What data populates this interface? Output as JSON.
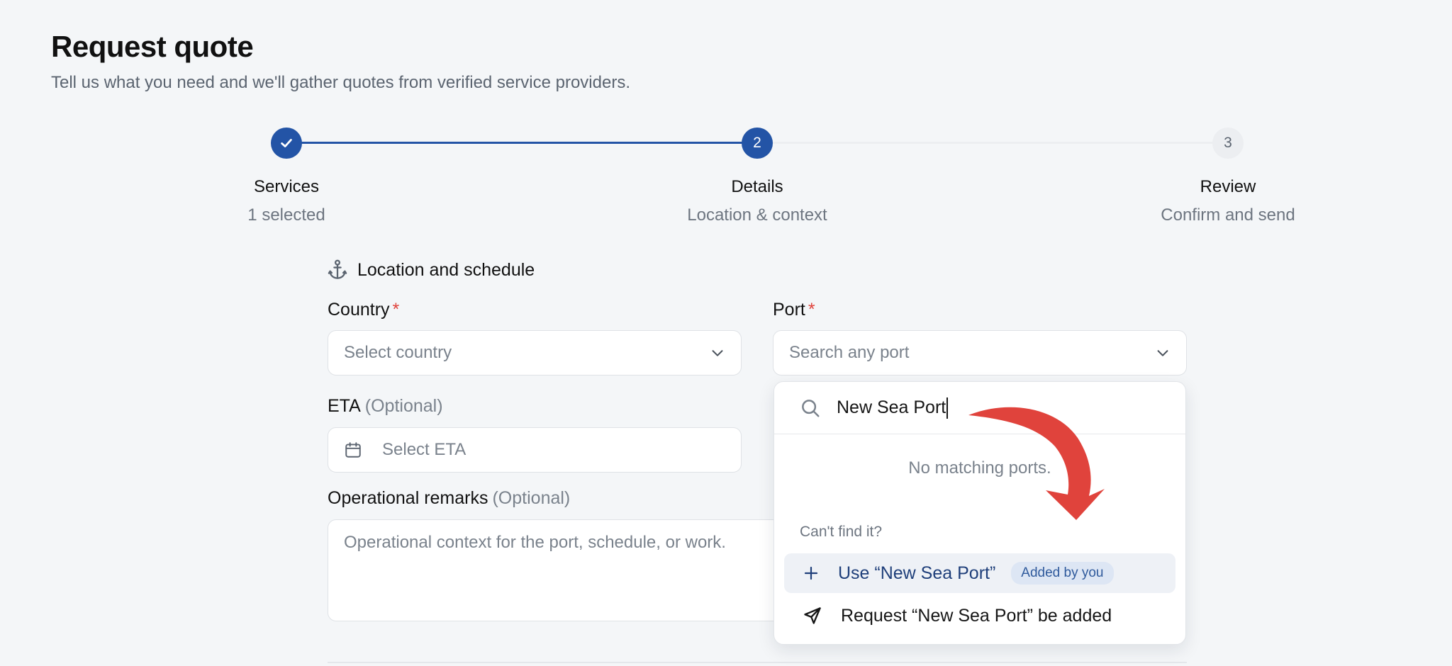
{
  "header": {
    "title": "Request quote",
    "subtitle": "Tell us what you need and we'll gather quotes from verified service providers."
  },
  "stepper": {
    "steps": [
      {
        "number": "",
        "label": "Services",
        "sub": "1 selected",
        "state": "done"
      },
      {
        "number": "2",
        "label": "Details",
        "sub": "Location & context",
        "state": "current"
      },
      {
        "number": "3",
        "label": "Review",
        "sub": "Confirm and send",
        "state": "upcoming"
      }
    ]
  },
  "form": {
    "section_title": "Location and schedule",
    "section_icon": "anchor-icon",
    "country": {
      "label": "Country",
      "required_mark": "*",
      "placeholder": "Select country"
    },
    "port": {
      "label": "Port",
      "required_mark": "*",
      "placeholder": "Search any port"
    },
    "eta": {
      "label": "ETA",
      "optional": "(Optional)",
      "placeholder": "Select ETA"
    },
    "remarks": {
      "label": "Operational remarks",
      "optional": "(Optional)",
      "placeholder": "Operational context for the port, schedule, or work."
    }
  },
  "port_dropdown": {
    "search_value": "New Sea Port",
    "empty_message": "No matching ports.",
    "cant_find": "Can't find it?",
    "use_option": "Use “New Sea Port”",
    "use_badge": "Added by you",
    "request_option": "Request “New Sea Port” be added"
  },
  "colors": {
    "accent": "#2354a6",
    "required": "#e0433c",
    "annotation": "#e0433c",
    "badge_bg": "#dde6f4"
  }
}
